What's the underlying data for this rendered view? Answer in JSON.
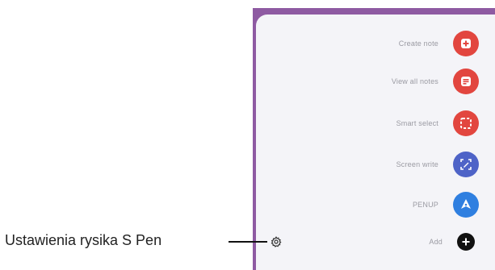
{
  "air_command": {
    "items": [
      {
        "label": "Create note",
        "icon": "create-note-icon",
        "color": "#e2463f"
      },
      {
        "label": "View all notes",
        "icon": "view-all-notes-icon",
        "color": "#e2463f"
      },
      {
        "label": "Smart select",
        "icon": "smart-select-icon",
        "color": "#e2463f"
      },
      {
        "label": "Screen write",
        "icon": "screen-write-icon",
        "color": "#4e63c7"
      },
      {
        "label": "PENUP",
        "icon": "penup-icon",
        "color": "#2f7fe0"
      },
      {
        "label": "Add",
        "icon": "add-icon",
        "color": "#111111"
      }
    ],
    "panel_color": "#8e5aa2"
  },
  "callout": {
    "text": "Ustawienia rysika S Pen"
  }
}
